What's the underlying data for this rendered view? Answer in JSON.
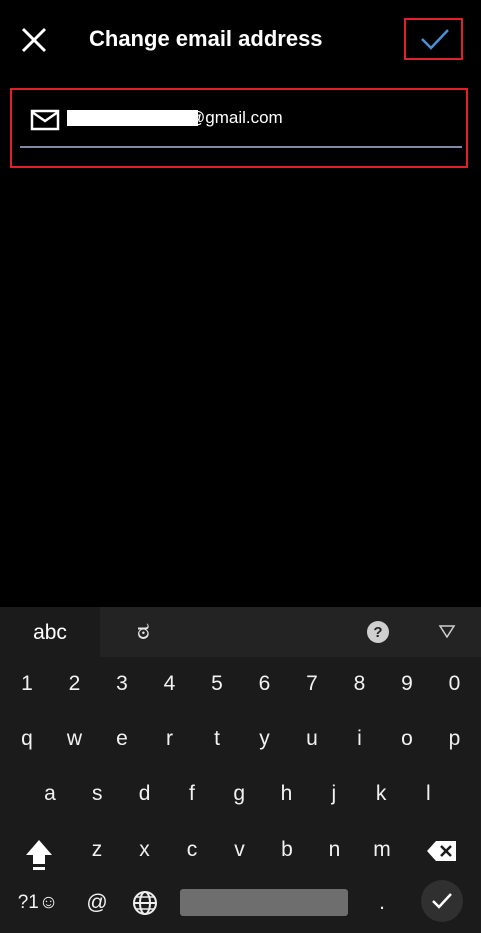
{
  "header": {
    "title": "Change email address",
    "close_icon": "close-icon",
    "confirm_icon": "checkmark-icon"
  },
  "email": {
    "value": "@gmail.com",
    "icon": "mail-icon"
  },
  "keyboard": {
    "tabs": {
      "abc": "abc",
      "kannada": "ಠ"
    },
    "number_row": [
      "1",
      "2",
      "3",
      "4",
      "5",
      "6",
      "7",
      "8",
      "9",
      "0"
    ],
    "row1": [
      "q",
      "w",
      "e",
      "r",
      "t",
      "y",
      "u",
      "i",
      "o",
      "p"
    ],
    "row2": [
      "a",
      "s",
      "d",
      "f",
      "g",
      "h",
      "j",
      "k",
      "l"
    ],
    "row3": [
      "z",
      "x",
      "c",
      "v",
      "b",
      "n",
      "m"
    ],
    "symbols_label": "?1☺",
    "at_label": "@",
    "period_label": "."
  },
  "colors": {
    "background": "#000000",
    "accent_check": "#4a90d9",
    "highlight_border": "#e0202a",
    "underline": "#7e8aa6"
  }
}
